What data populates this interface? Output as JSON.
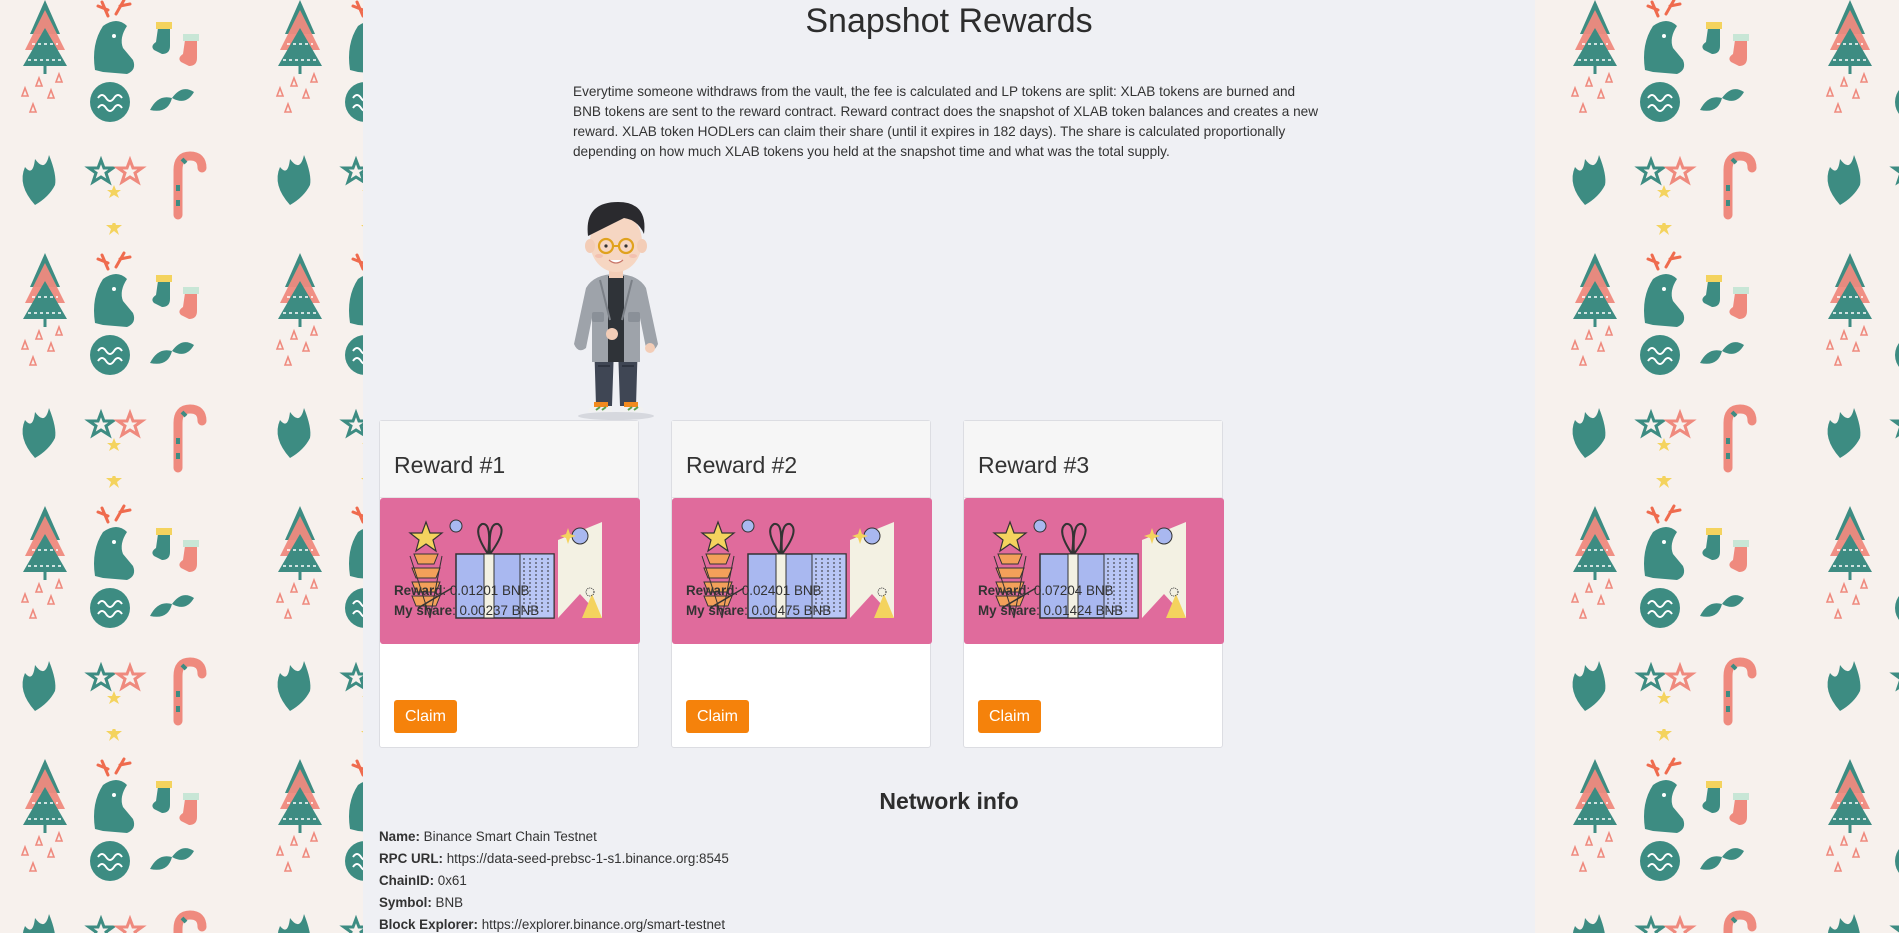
{
  "page": {
    "title": "Snapshot Rewards",
    "intro": "Everytime someone withdraws from the vault, the fee is calculated and LP tokens are split: XLAB tokens are burned and BNB tokens are sent to the reward contract. Reward contract does the snapshot of XLAB token balances and creates a new reward. XLAB token HODLers can claim their share (until it expires in 182 days). The share is calculated proportionally depending on how much XLAB tokens you held at the snapshot time and what was the total supply."
  },
  "rewards": [
    {
      "title": "Reward #1",
      "reward_label": "Reward",
      "reward_value": ": 0.01201 BNB",
      "share_label": "My share",
      "share_value": ": 0.00237 BNB",
      "claim_label": "Claim"
    },
    {
      "title": "Reward #2",
      "reward_label": "Reward",
      "reward_value": ": 0.02401 BNB",
      "share_label": "My share",
      "share_value": ": 0.00475 BNB",
      "claim_label": "Claim"
    },
    {
      "title": "Reward #3",
      "reward_label": "Reward",
      "reward_value": ": 0.07204 BNB",
      "share_label": "My share",
      "share_value": ": 0.01424 BNB",
      "claim_label": "Claim"
    }
  ],
  "network": {
    "title": "Network info",
    "rows": [
      {
        "label": "Name:",
        "value": " Binance Smart Chain Testnet"
      },
      {
        "label": "RPC URL:",
        "value": " https://data-seed-prebsc-1-s1.binance.org:8545"
      },
      {
        "label": "ChainID:",
        "value": " 0x61"
      },
      {
        "label": "Symbol:",
        "value": " BNB"
      },
      {
        "label": "Block Explorer:",
        "value": " https://explorer.binance.org/smart-testnet"
      }
    ]
  },
  "colors": {
    "accent": "#f5820b",
    "card_image_bg": "#e06b9c",
    "pattern_green": "#3d8c82",
    "pattern_pink": "#ef8a7e",
    "pattern_yellow": "#f4d35e"
  },
  "icons": [
    "christmas-tree-icon",
    "reindeer-icon",
    "stocking-icon",
    "candy-cane-icon",
    "star-icon",
    "ornament-icon",
    "leaf-icon",
    "gift-icon",
    "avatar-illustration"
  ]
}
